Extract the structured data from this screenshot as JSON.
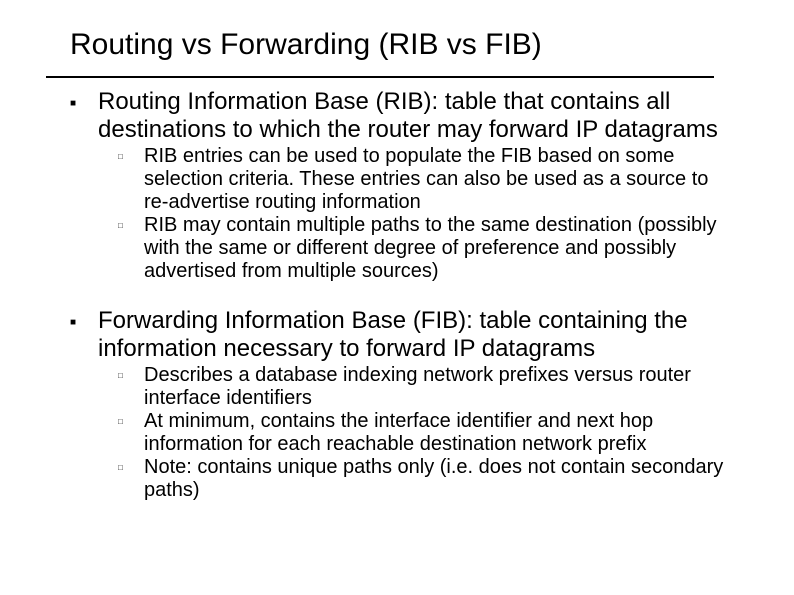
{
  "slide": {
    "title": "Routing vs Forwarding (RIB vs FIB)",
    "items": [
      {
        "text": "Routing Information Base (RIB): table that contains all destinations to which the router may forward IP datagrams",
        "sub": [
          "RIB entries can be used to populate the FIB based on some selection criteria. These entries can also be used as a source to re-advertise routing information",
          "RIB may contain multiple paths to the same destination (possibly with the same or different degree of preference and possibly advertised from multiple sources)"
        ]
      },
      {
        "text": "Forwarding Information Base (FIB): table containing the information necessary to forward IP datagrams",
        "sub": [
          "Describes a database indexing network prefixes versus router interface identifiers",
          "At minimum, contains the interface identifier and next hop information for each reachable destination network prefix",
          "Note: contains unique paths only (i.e. does not contain secondary paths)"
        ]
      }
    ]
  }
}
